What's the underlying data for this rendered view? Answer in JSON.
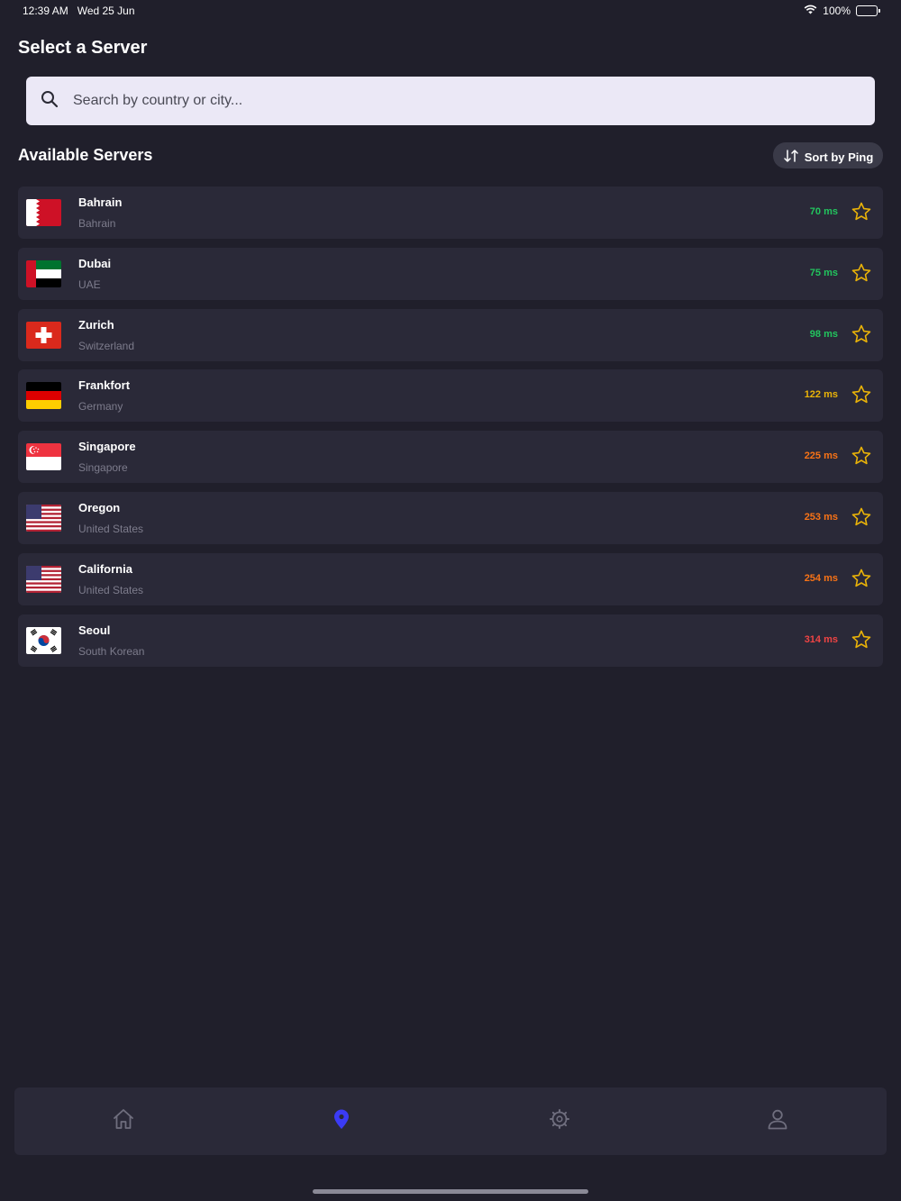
{
  "status_bar": {
    "time": "12:39 AM",
    "date": "Wed 25 Jun",
    "battery": "100%",
    "icons": [
      "wifi-icon",
      "battery-icon"
    ]
  },
  "page": {
    "title": "Select a Server"
  },
  "search": {
    "placeholder": "Search by country or city...",
    "value": "",
    "icon": "search-icon"
  },
  "section": {
    "title": "Available Servers",
    "sort_label": "Sort by Ping",
    "sort_icon": "sort-arrows-icon"
  },
  "colors": {
    "background": "#201f2b",
    "card": "#2a2938",
    "ping_good": "#22c55e",
    "ping_medium": "#eab308",
    "ping_slow": "#f97316",
    "ping_bad": "#ef4444",
    "star": "#eab308",
    "nav_active": "#3b3bf5",
    "nav_inactive": "#6f6e7e"
  },
  "servers": [
    {
      "city": "Bahrain",
      "country": "Bahrain",
      "ping": "70 ms",
      "ping_color": "#22c55e",
      "flag": "bahrain-flag",
      "favorite": false
    },
    {
      "city": "Dubai",
      "country": "UAE",
      "ping": "75 ms",
      "ping_color": "#22c55e",
      "flag": "uae-flag",
      "favorite": false
    },
    {
      "city": "Zurich",
      "country": "Switzerland",
      "ping": "98 ms",
      "ping_color": "#22c55e",
      "flag": "switzerland-flag",
      "favorite": false
    },
    {
      "city": "Frankfort",
      "country": "Germany",
      "ping": "122 ms",
      "ping_color": "#eab308",
      "flag": "germany-flag",
      "favorite": false
    },
    {
      "city": "Singapore",
      "country": "Singapore",
      "ping": "225 ms",
      "ping_color": "#f97316",
      "flag": "singapore-flag",
      "favorite": false
    },
    {
      "city": "Oregon",
      "country": "United States",
      "ping": "253 ms",
      "ping_color": "#f97316",
      "flag": "usa-flag",
      "favorite": false
    },
    {
      "city": "California",
      "country": "United States",
      "ping": "254 ms",
      "ping_color": "#f97316",
      "flag": "usa-flag",
      "favorite": false
    },
    {
      "city": "Seoul",
      "country": "South Korean",
      "ping": "314 ms",
      "ping_color": "#ef4444",
      "flag": "south-korea-flag",
      "favorite": false
    }
  ],
  "bottom_nav": {
    "items": [
      {
        "icon": "home-icon",
        "active": false
      },
      {
        "icon": "location-pin-icon",
        "active": true
      },
      {
        "icon": "settings-gear-icon",
        "active": false
      },
      {
        "icon": "profile-icon",
        "active": false
      }
    ]
  }
}
